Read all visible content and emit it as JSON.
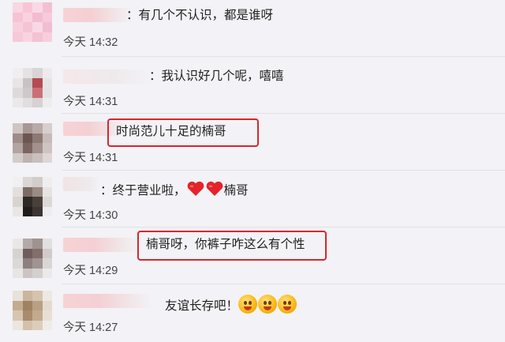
{
  "comments": [
    {
      "text": "：有几个不认识，都是谁呀",
      "time": "今天 14:32",
      "highlighted": false
    },
    {
      "text": "：我认识好几个呢，嘻嘻",
      "time": "今天 14:31",
      "highlighted": false
    },
    {
      "text": "时尚范儿十足的楠哥",
      "time": "今天 14:31",
      "highlighted": true
    },
    {
      "text_before": "：终于营业啦，",
      "text_after": "楠哥",
      "emoji": [
        "red-heart",
        "red-heart"
      ],
      "time": "今天 14:30",
      "highlighted": false
    },
    {
      "text": "楠哥呀，你裤子咋这么有个性",
      "time": "今天 14:29",
      "highlighted": true
    },
    {
      "text": "友谊长存吧！",
      "emoji": [
        "yum-face",
        "yum-face",
        "yum-face"
      ],
      "time": "今天 14:27",
      "highlighted": false
    }
  ],
  "colors": {
    "highlight_box": "#d8262f",
    "background": "#f3f2f6",
    "heart": "#e3242b"
  }
}
